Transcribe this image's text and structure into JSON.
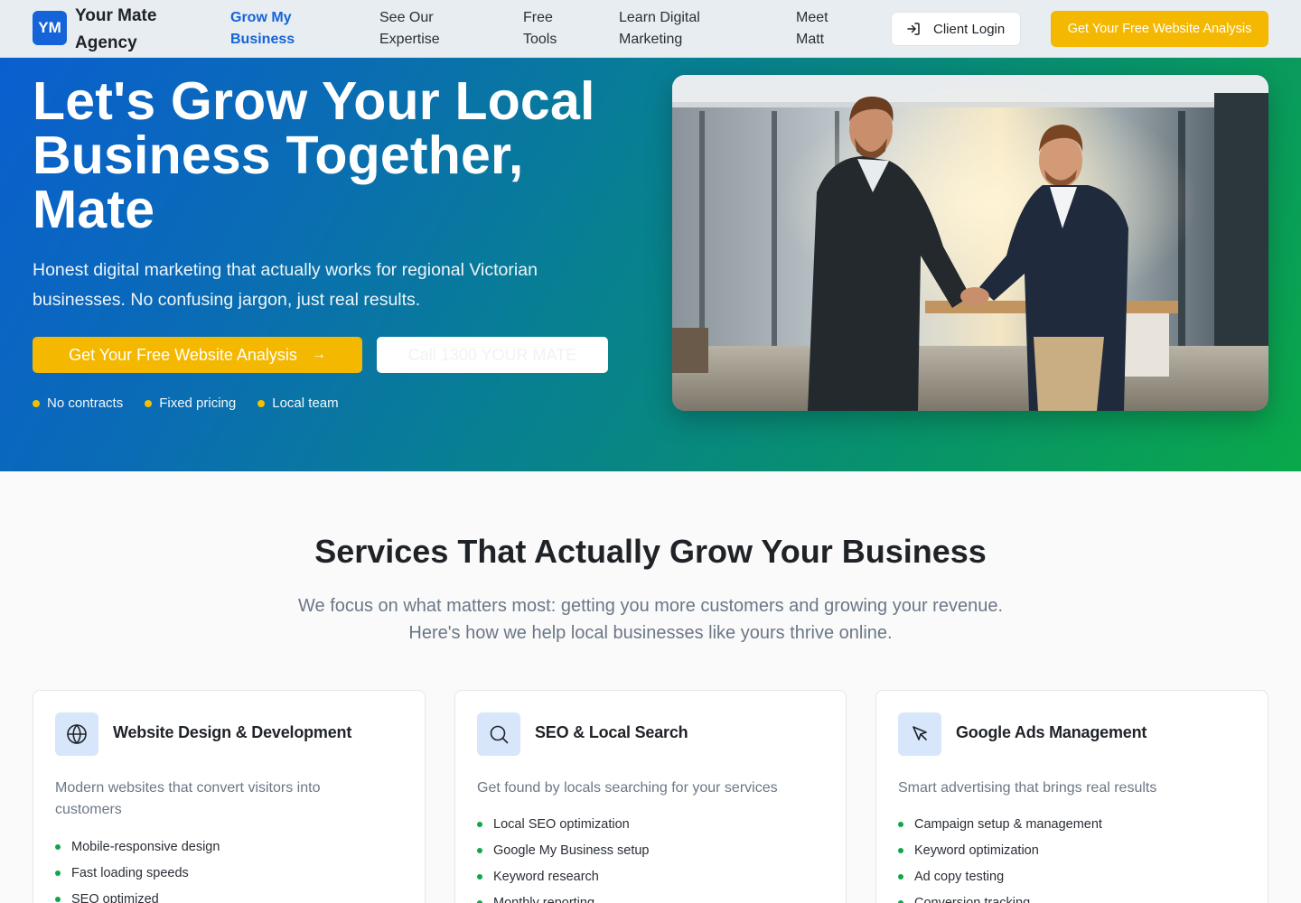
{
  "brand": {
    "badge": "YM",
    "name": "Your Mate Agency"
  },
  "nav": {
    "items": [
      {
        "label": "Grow My Business",
        "active": true
      },
      {
        "label": "See Our Expertise",
        "active": false
      },
      {
        "label": "Free Tools",
        "active": false
      },
      {
        "label": "Learn Digital Marketing",
        "active": false
      },
      {
        "label": "Meet Matt",
        "active": false
      }
    ],
    "client_login": "Client Login",
    "cta": "Get Your Free Website Analysis"
  },
  "hero": {
    "title": "Let's Grow Your Local Business Together, Mate",
    "subtitle": "Honest digital marketing that actually works for regional Victorian businesses. No confusing jargon, just real results.",
    "primary_cta": "Get Your Free Website Analysis",
    "secondary_cta": "Call 1300 YOUR MATE",
    "bullets": [
      "No contracts",
      "Fixed pricing",
      "Local team"
    ],
    "image_alt": "Two businessmen shaking hands in an office"
  },
  "services": {
    "title": "Services That Actually Grow Your Business",
    "subtitle": "We focus on what matters most: getting you more customers and growing your revenue. Here's how we help local businesses like yours thrive online.",
    "cards": [
      {
        "icon": "globe-icon",
        "title": "Website Design & Development",
        "description": "Modern websites that convert visitors into customers",
        "features": [
          "Mobile-responsive design",
          "Fast loading speeds",
          "SEO optimized"
        ]
      },
      {
        "icon": "search-icon",
        "title": "SEO & Local Search",
        "description": "Get found by locals searching for your services",
        "features": [
          "Local SEO optimization",
          "Google My Business setup",
          "Keyword research",
          "Monthly reporting"
        ]
      },
      {
        "icon": "cursor-icon",
        "title": "Google Ads Management",
        "description": "Smart advertising that brings real results",
        "features": [
          "Campaign setup & management",
          "Keyword optimization",
          "Ad copy testing",
          "Conversion tracking"
        ]
      }
    ]
  },
  "colors": {
    "primary_blue": "#1463d9",
    "accent_yellow": "#f5b800",
    "success_green": "#10a54a"
  }
}
